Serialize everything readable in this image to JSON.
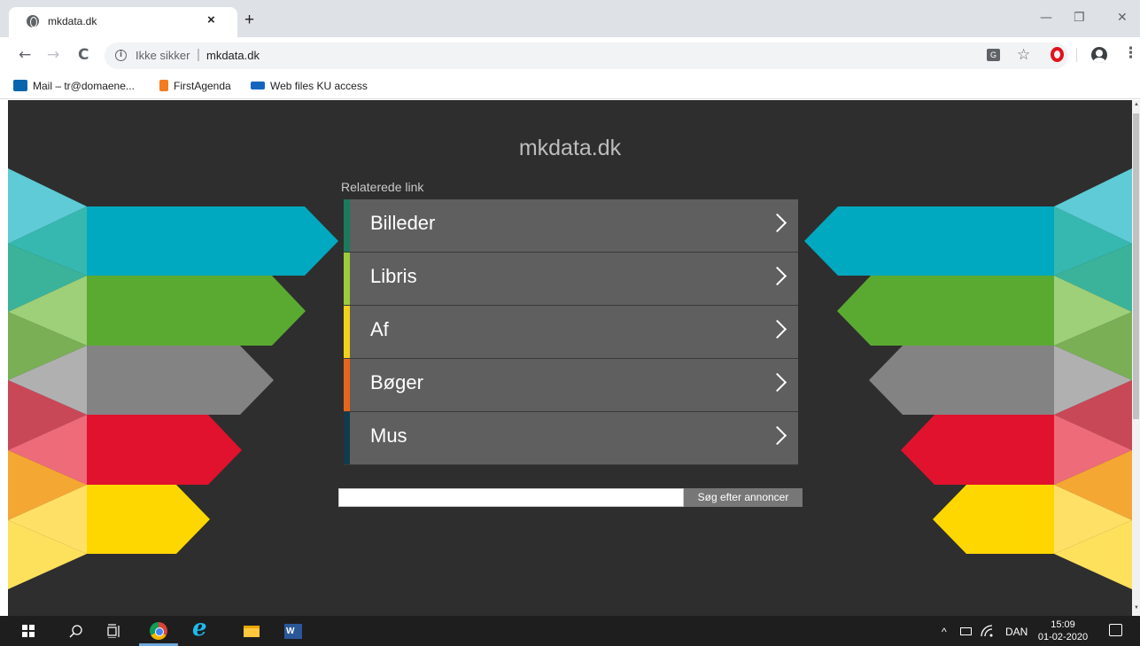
{
  "browser": {
    "tab_title": "mkdata.dk",
    "tab_close": "×",
    "new_tab": "+",
    "window_controls": {
      "minimize": "—",
      "restore": "❐",
      "close": "✕"
    },
    "nav": {
      "back": "←",
      "forward": "→",
      "reload": "C"
    },
    "address": {
      "info_icon": "i",
      "security_text": "Ikke sikker",
      "separator": "|",
      "url": "mkdata.dk"
    },
    "kebab": "⋮",
    "star": "☆",
    "translate": "G"
  },
  "bookmarks": [
    {
      "label": "Mail – tr@domaene...",
      "icon_color": "#0a64ad"
    },
    {
      "label": "FirstAgenda",
      "icon_color": "#f47c20"
    },
    {
      "label": "Web files KU access",
      "icon_color": "#1565c0"
    }
  ],
  "page": {
    "site_title": "mkdata.dk",
    "related_heading": "Relaterede link",
    "links": [
      {
        "label": "Billeder",
        "accent": "#1a7a5c"
      },
      {
        "label": "Libris",
        "accent": "#9ccb3b"
      },
      {
        "label": "Af",
        "accent": "#f2d11a"
      },
      {
        "label": "Bøger",
        "accent": "#e8661b"
      },
      {
        "label": "Mus",
        "accent": "#123a4a"
      }
    ],
    "search": {
      "input_value": "",
      "button_label": "Søg efter annoncer"
    }
  },
  "taskbar": {
    "tray_arrow": "^",
    "language": "DAN",
    "time": "15:09",
    "date": "01-02-2020",
    "word_label": "W"
  }
}
